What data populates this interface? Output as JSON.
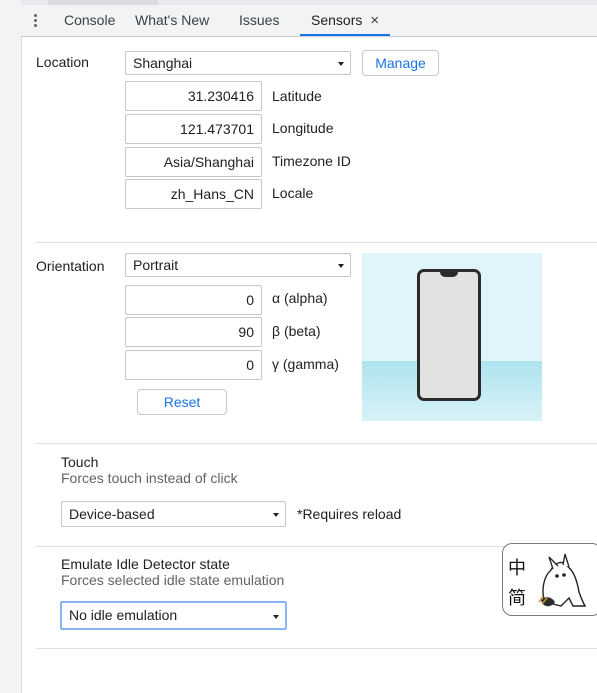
{
  "tabs": [
    {
      "label": "Console"
    },
    {
      "label": "What's New"
    },
    {
      "label": "Issues"
    },
    {
      "label": "Sensors",
      "close": "×",
      "active": true
    }
  ],
  "location": {
    "label": "Location",
    "selected": "Shanghai",
    "manage_label": "Manage",
    "fields": [
      {
        "value": "31.230416",
        "label": "Latitude"
      },
      {
        "value": "121.473701",
        "label": "Longitude"
      },
      {
        "value": "Asia/Shanghai",
        "label": "Timezone ID"
      },
      {
        "value": "zh_Hans_CN",
        "label": "Locale"
      }
    ]
  },
  "orientation": {
    "label": "Orientation",
    "selected": "Portrait",
    "fields": [
      {
        "value": "0",
        "label": "α (alpha)"
      },
      {
        "value": "90",
        "label": "β (beta)"
      },
      {
        "value": "0",
        "label": "γ (gamma)"
      }
    ],
    "reset_label": "Reset"
  },
  "touch": {
    "title": "Touch",
    "description": "Forces touch instead of click",
    "selected": "Device-based",
    "note": "*Requires reload"
  },
  "idle": {
    "title": "Emulate Idle Detector state",
    "description": "Forces selected idle state emulation",
    "selected": "No idle emulation"
  },
  "ime": {
    "line1": "中",
    "line2": "简"
  },
  "colors": {
    "accent": "#1a73e8",
    "sky": "#dff4fb",
    "water": "#aee3ee"
  }
}
